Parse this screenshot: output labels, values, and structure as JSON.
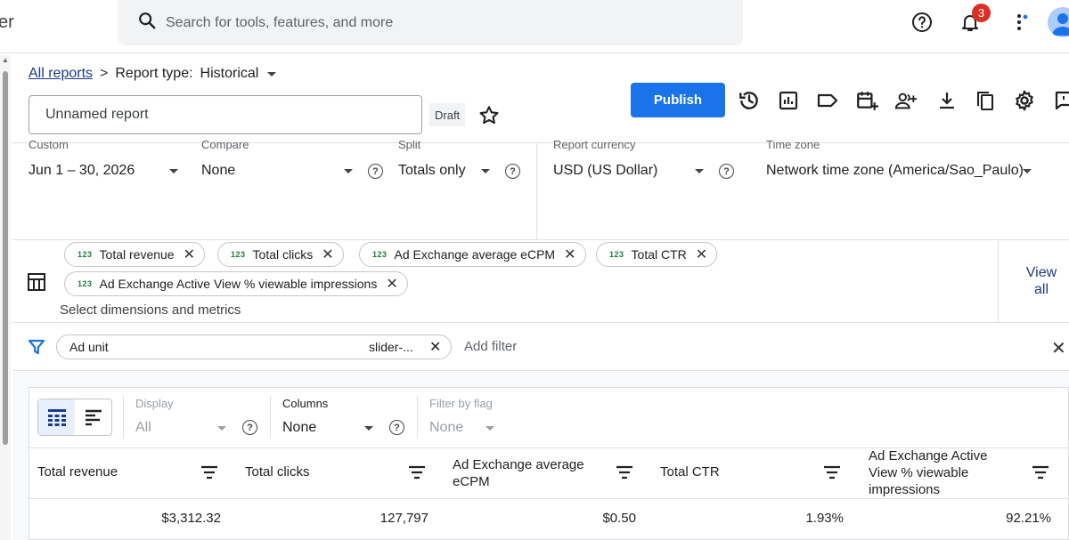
{
  "app": {
    "brand_fragment": "er"
  },
  "search": {
    "placeholder": "Search for tools, features, and more"
  },
  "notifications": {
    "count": "3"
  },
  "breadcrumb": {
    "all_reports": "All reports",
    "separator": ">",
    "report_type_label": "Report type:",
    "report_type_value": "Historical"
  },
  "report": {
    "name_placeholder": "Unnamed report",
    "status": "Draft",
    "publish_label": "Publish"
  },
  "settings": {
    "date": {
      "label": "Custom",
      "value": "Jun 1 – 30, 2026"
    },
    "compare": {
      "label": "Compare",
      "value": "None"
    },
    "split": {
      "label": "Split",
      "value": "Totals only"
    },
    "currency": {
      "label": "Report currency",
      "value": "USD (US Dollar)"
    },
    "timezone": {
      "label": "Time zone",
      "value": "Network time zone (America/Sao_Paulo)"
    }
  },
  "metrics": {
    "chip_tag": "123",
    "chips": [
      "Total revenue",
      "Total clicks",
      "Ad Exchange average eCPM",
      "Total CTR",
      "Ad Exchange Active View % viewable impressions"
    ],
    "select_label": "Select dimensions and metrics",
    "view_all_line1": "View",
    "view_all_line2": "all"
  },
  "filter": {
    "label": "Ad unit",
    "value": "slider-...",
    "add_label": "Add filter"
  },
  "table_options": {
    "display": {
      "label": "Display",
      "value": "All"
    },
    "columns": {
      "label": "Columns",
      "value": "None"
    },
    "flag": {
      "label": "Filter by flag",
      "value": "None"
    }
  },
  "table": {
    "headers": [
      "Total revenue",
      "Total clicks",
      "Ad Exchange average eCPM",
      "Total CTR",
      "Ad Exchange Active View % viewable impressions"
    ],
    "row": [
      "$3,312.32",
      "127,797",
      "$0.50",
      "1.93%",
      "92.21%"
    ]
  },
  "colors": {
    "accent": "#1a73e8",
    "link": "#1a3a8a",
    "badge": "#d93025",
    "metric_tag": "#188038"
  }
}
